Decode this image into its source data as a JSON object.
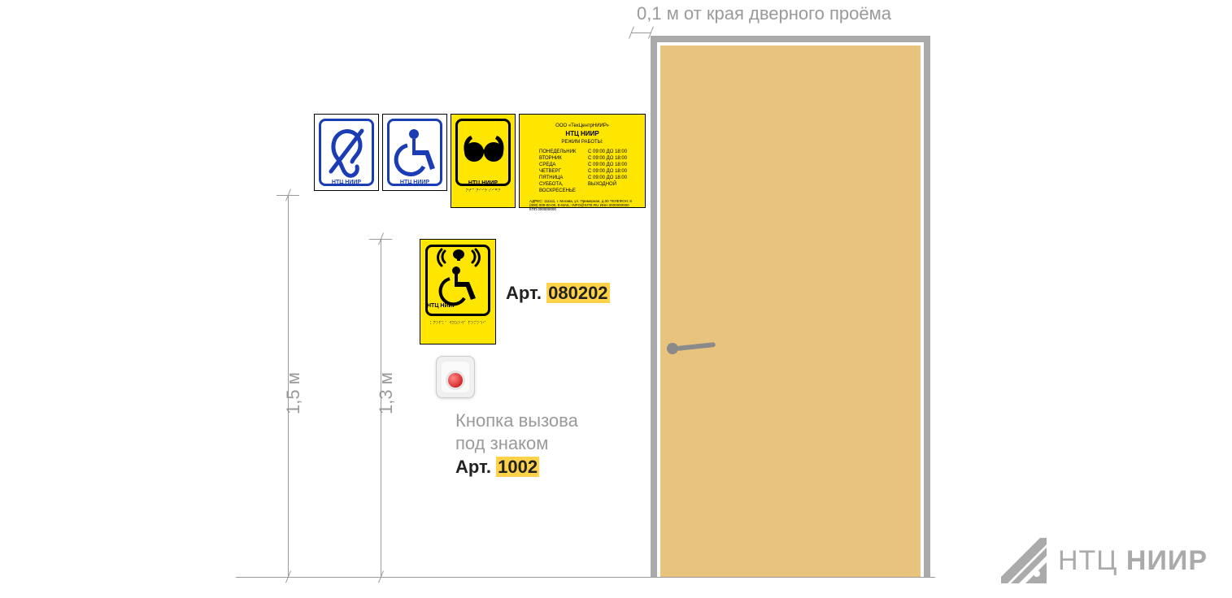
{
  "top_dimension_label": "0,1 м от края дверного проёма",
  "dimensions": {
    "outer": "1,5 м",
    "inner": "1,3 м"
  },
  "signs": {
    "hearing": {
      "label": "НТЦ НИИР"
    },
    "wheelchair": {
      "label": "НТЦ НИИР"
    },
    "glasses": {
      "label": "НТЦ НИИР",
      "braille": "⠝⠞⠉ ⠝⠊⠊⠗\n⠎⠊⠛⠝"
    },
    "info": {
      "company": "ООО «ТехЦентрНИИР»",
      "title": "НТЦ НИИР",
      "subtitle": "РЕЖИМ РАБОТЫ:",
      "schedule": [
        {
          "day": "ПОНЕДЕЛЬНИК",
          "hours": "С 09:00 ДО 18:00"
        },
        {
          "day": "ВТОРНИК",
          "hours": "С 09:00 ДО 18:00"
        },
        {
          "day": "СРЕДА",
          "hours": "С 09:00 ДО 18:00"
        },
        {
          "day": "ЧЕТВЕРГ",
          "hours": "С 09:00 ДО 18:00"
        },
        {
          "day": "ПЯТНИЦА",
          "hours": "С 09:00 ДО 18:00"
        },
        {
          "day": "СУББОТА, ВОСКРЕСЕНЬЕ",
          "hours": "ВЫХОДНОЙ"
        }
      ],
      "address": "АДРЕС: 111111, г. Москва, ул. Примерная, д.00\nТЕЛЕФОН: 8 (000) 000-00-00, E-MAIL: INFO@SITE.RU\nИНН 0000000000 КПП 000000000"
    }
  },
  "call_sign": {
    "label": "НТЦ НИИР",
    "braille": "⠅⠝⠕⠏⠅⠁ ⠺⠽⠵⠕⠺⠁\n⠏⠕⠍⠕⠱⠊"
  },
  "articles": {
    "sign_prefix": "Арт.",
    "sign_code": "080202",
    "button_note_line1": "Кнопка вызова",
    "button_note_line2": "под знаком",
    "button_prefix": "Арт.",
    "button_code": "1002"
  },
  "logo": {
    "part1": "НТЦ",
    "part2": "НИИР"
  }
}
